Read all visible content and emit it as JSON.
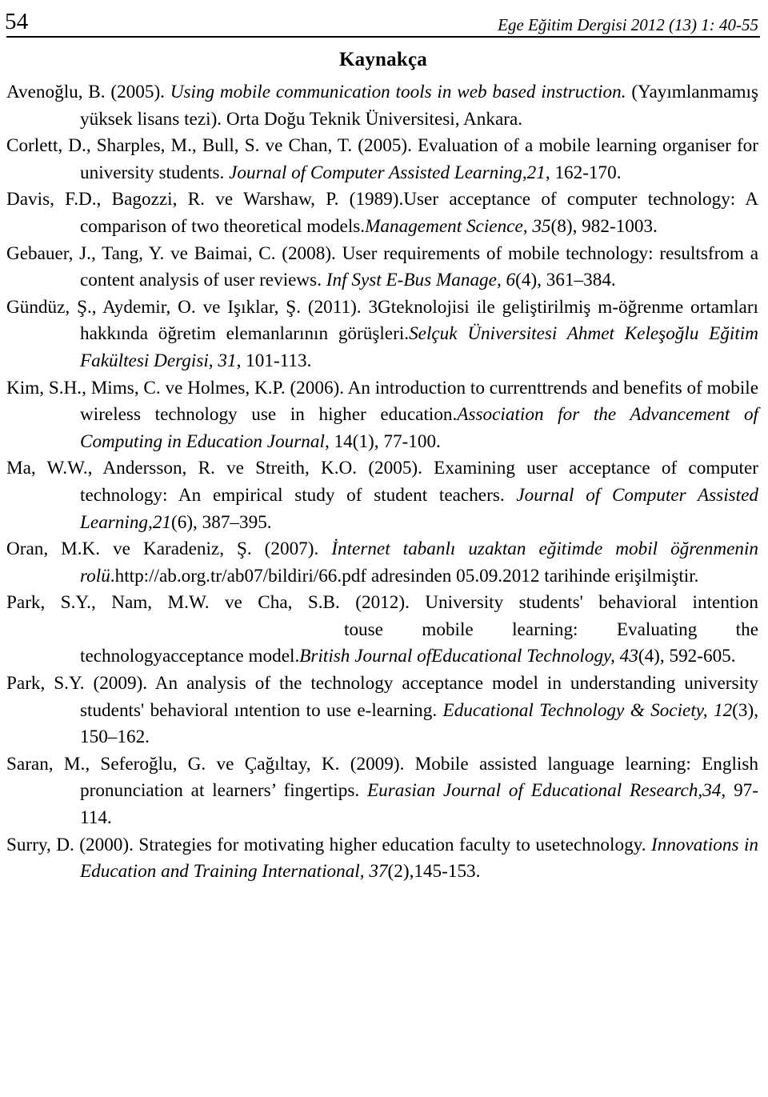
{
  "header": {
    "page_number": "54",
    "running_title": "Ege Eğitim Dergisi 2012 (13) 1: 40-55"
  },
  "section": {
    "heading": "Kaynakça"
  },
  "references": [
    {
      "id": "avenoglu-2005",
      "author_year": "Avenoğlu, B. (2005). ",
      "title_italic": "Using mobile communication tools in web based instruction.",
      "rest": " (Yayımlanmamış yüksek lisans tezi). Orta Doğu Teknik Üniversitesi, Ankara."
    },
    {
      "id": "corlett-2005",
      "author_year": "Corlett, D., Sharples, M., Bull, S. ve Chan, T. (2005). Evaluation of a mobile learning organiser for university students. ",
      "source_italic": "Journal of Computer Assisted Learning,21",
      "rest": ", 162-170."
    },
    {
      "id": "davis-1989",
      "author_year": "Davis, F.D., Bagozzi, R. ve Warshaw, P. (1989).User acceptance of computer technology: A comparison of two theoretical models.",
      "source_italic": "Management Science, 35",
      "rest": "(8), 982-1003."
    },
    {
      "id": "gebauer-2008",
      "author_year": "Gebauer, J., Tang, Y. ve Baimai, C. (2008). User requirements of mobile technology: resultsfrom a content analysis of user reviews. ",
      "source_italic": "Inf Syst E-Bus Manage, 6",
      "rest": "(4), 361–384."
    },
    {
      "id": "gunduz-2011",
      "author_year": "Gündüz, Ş., Aydemir, O. ve Işıklar, Ş. (2011). 3Gteknolojisi ile geliştirilmiş m-öğrenme ortamları hakkında öğretim elemanlarının görüşleri.",
      "source_italic": "Selçuk Üniversitesi Ahmet Keleşoğlu Eğitim Fakültesi Dergisi, 31",
      "rest": ", 101-113."
    },
    {
      "id": "kim-2006",
      "author_year": "Kim, S.H., Mims, C. ve Holmes, K.P. (2006). An introduction to currenttrends and benefits of mobile wireless technology use in higher education.",
      "source_italic": "Association for the Advancement of Computing in Education Journal",
      "rest": ", 14(1), 77-100."
    },
    {
      "id": "ma-2005",
      "author_year": "Ma, W.W., Andersson, R. ve Streith, K.O. (2005). Examining user acceptance of computer technology: An empirical study of student teachers. ",
      "source_italic": "Journal of Computer Assisted Learning,21",
      "rest": "(6), 387–395."
    },
    {
      "id": "oran-2007",
      "author_year": "Oran, M.K. ve Karadeniz, Ş. (2007). ",
      "title_italic": "İnternet tabanlı uzaktan eğitimde mobil öğrenmenin rolü",
      "rest": ".http://ab.org.tr/ab07/bildiri/66.pdf adresinden 05.09.2012 tarihinde erişilmiştir."
    },
    {
      "id": "park-2012",
      "author_year": "Park, S.Y., Nam, M.W. ve Cha, S.B. (2012). University students' behavioral intention",
      "gap_after": "touse mobile learning: Evaluating the technologyacceptance model.",
      "source_italic": "British Journal ofEducational Technology, 43",
      "rest": "(4), 592-605."
    },
    {
      "id": "park-2009",
      "author_year": "Park, S.Y. (2009). An analysis of the technology acceptance model in understanding university students' behavioral ıntention to use e-learning. ",
      "source_italic": "Educational Technology & Society, 12",
      "rest": "(3), 150–162."
    },
    {
      "id": "saran-2009",
      "author_year": "Saran, M., Seferoğlu, G. ve Çağıltay, K. (2009). Mobile assisted language learning: English pronunciation at learners’ fingertips. ",
      "source_italic": "Eurasian Journal of Educational Research,34",
      "rest": ", 97-114."
    },
    {
      "id": "surry-2000",
      "author_year": "Surry, D. (2000). Strategies for motivating higher education faculty to usetechnology. ",
      "source_italic": "Innovations in Education and Training International, 37",
      "rest": "(2),145-153."
    }
  ]
}
